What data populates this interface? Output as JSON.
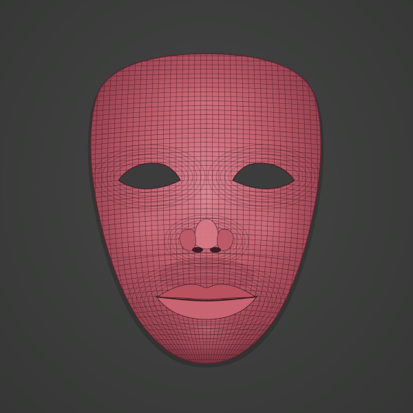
{
  "scene": {
    "background_color": "#3b3c3b",
    "model": {
      "kind": "face-mask",
      "render_mode": "wireframe-over-shaded",
      "surface_color": "#c35f6e",
      "surface_highlight": "#e28a96",
      "surface_shadow": "#6e2a36",
      "wire_color": "#3a1f24"
    }
  }
}
